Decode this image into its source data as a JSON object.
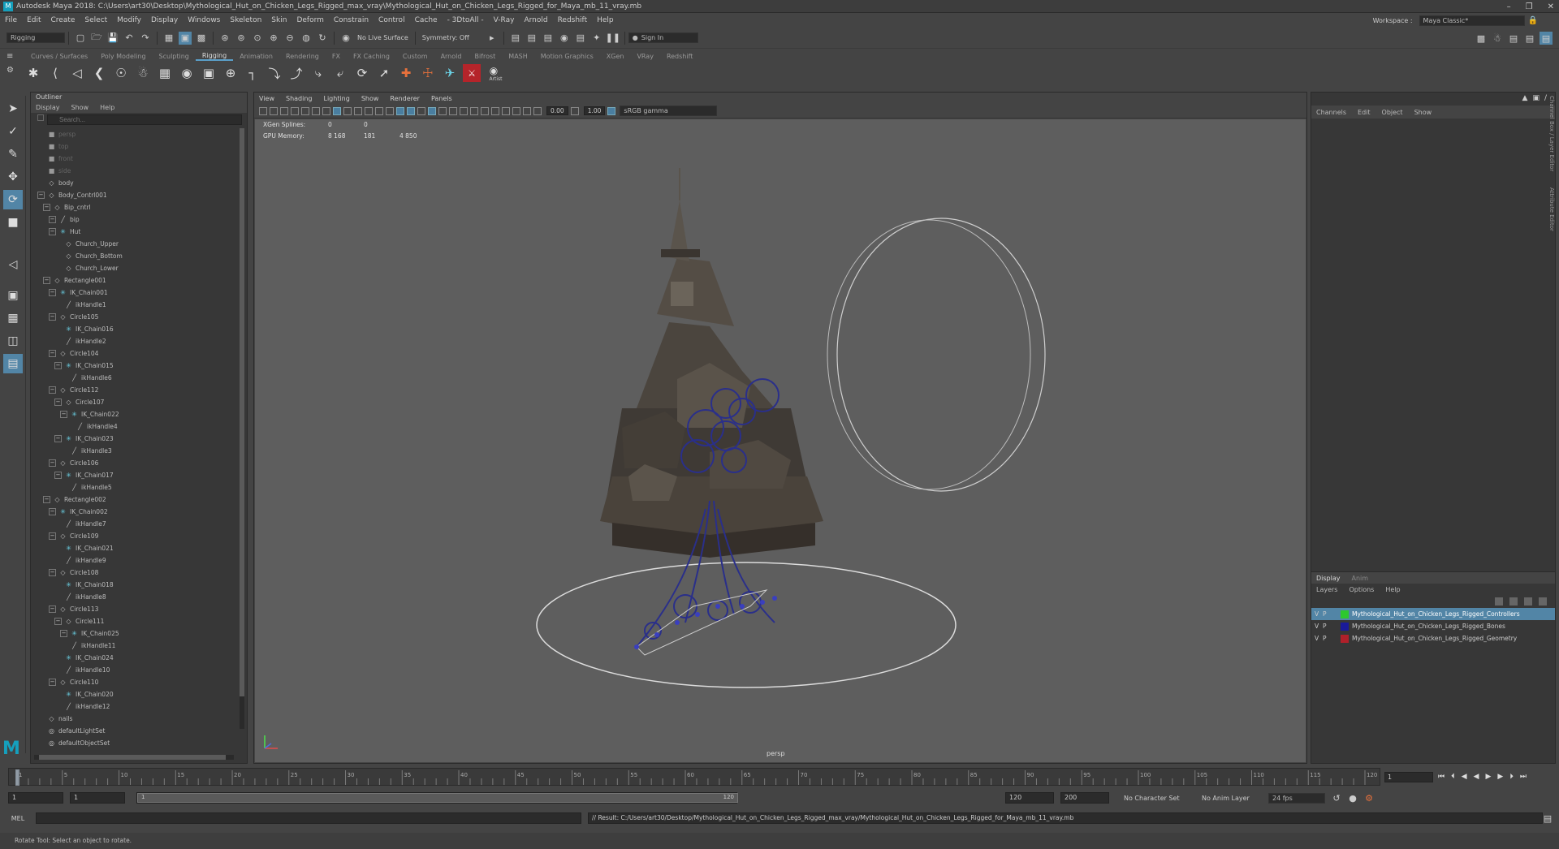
{
  "title": "Autodesk Maya 2018: C:\\Users\\art30\\Desktop\\Mythological_Hut_on_Chicken_Legs_Rigged_max_vray\\Mythological_Hut_on_Chicken_Legs_Rigged_for_Maya_mb_11_vray.mb",
  "menu": [
    "File",
    "Edit",
    "Create",
    "Select",
    "Modify",
    "Display",
    "Windows",
    "Skeleton",
    "Skin",
    "Deform",
    "Constrain",
    "Control",
    "Cache",
    "- 3DtoAll -",
    "V-Ray",
    "Arnold",
    "Redshift",
    "Help"
  ],
  "workspace": {
    "label": "Workspace :",
    "value": "Maya Classic*"
  },
  "statusline": {
    "mode": "Rigging",
    "live_surface": "No Live Surface",
    "symmetry": "Symmetry: Off",
    "sign_in": "Sign In"
  },
  "shelf_tabs": [
    "Curves / Surfaces",
    "Poly Modeling",
    "Sculpting",
    "Rigging",
    "Animation",
    "Rendering",
    "FX",
    "FX Caching",
    "Custom",
    "Arnold",
    "Bifrost",
    "MASH",
    "Motion Graphics",
    "XGen",
    "VRay",
    "Redshift"
  ],
  "shelf_active": "Rigging",
  "shelf_extra_label": "Artist",
  "outliner": {
    "title": "Outliner",
    "menu": [
      "Display",
      "Show",
      "Help"
    ],
    "search_placeholder": "Search...",
    "items": [
      {
        "label": "persp",
        "depth": 0,
        "icon": "cam",
        "dim": true,
        "exp": ""
      },
      {
        "label": "top",
        "depth": 0,
        "icon": "cam",
        "dim": true,
        "exp": ""
      },
      {
        "label": "front",
        "depth": 0,
        "icon": "cam",
        "dim": true,
        "exp": ""
      },
      {
        "label": "side",
        "depth": 0,
        "icon": "cam",
        "dim": true,
        "exp": ""
      },
      {
        "label": "body",
        "depth": 0,
        "icon": "tr",
        "exp": ""
      },
      {
        "label": "Body_Contrl001",
        "depth": 0,
        "icon": "tr",
        "exp": "−"
      },
      {
        "label": "Bip_cntrl",
        "depth": 1,
        "icon": "tr",
        "exp": "−"
      },
      {
        "label": "bip",
        "depth": 2,
        "icon": "ik",
        "exp": "−"
      },
      {
        "label": "Hut",
        "depth": 2,
        "icon": "joint",
        "exp": "−"
      },
      {
        "label": "Church_Upper",
        "depth": 3,
        "icon": "tr",
        "exp": ""
      },
      {
        "label": "Church_Bottom",
        "depth": 3,
        "icon": "tr",
        "exp": ""
      },
      {
        "label": "Church_Lower",
        "depth": 3,
        "icon": "tr",
        "exp": ""
      },
      {
        "label": "Rectangle001",
        "depth": 1,
        "icon": "tr",
        "exp": "−"
      },
      {
        "label": "IK_Chain001",
        "depth": 2,
        "icon": "joint",
        "exp": "−"
      },
      {
        "label": "ikHandle1",
        "depth": 3,
        "icon": "ik",
        "exp": ""
      },
      {
        "label": "Circle105",
        "depth": 2,
        "icon": "tr",
        "exp": "−"
      },
      {
        "label": "IK_Chain016",
        "depth": 3,
        "icon": "joint",
        "exp": ""
      },
      {
        "label": "ikHandle2",
        "depth": 3,
        "icon": "ik",
        "exp": ""
      },
      {
        "label": "Circle104",
        "depth": 2,
        "icon": "tr",
        "exp": "−"
      },
      {
        "label": "IK_Chain015",
        "depth": 3,
        "icon": "joint",
        "exp": "−"
      },
      {
        "label": "ikHandle6",
        "depth": 4,
        "icon": "ik",
        "exp": ""
      },
      {
        "label": "Circle112",
        "depth": 2,
        "icon": "tr",
        "exp": "−"
      },
      {
        "label": "Circle107",
        "depth": 3,
        "icon": "tr",
        "exp": "−"
      },
      {
        "label": "IK_Chain022",
        "depth": 4,
        "icon": "joint",
        "exp": "−"
      },
      {
        "label": "ikHandle4",
        "depth": 5,
        "icon": "ik",
        "exp": ""
      },
      {
        "label": "IK_Chain023",
        "depth": 3,
        "icon": "joint",
        "exp": "−"
      },
      {
        "label": "ikHandle3",
        "depth": 4,
        "icon": "ik",
        "exp": ""
      },
      {
        "label": "Circle106",
        "depth": 2,
        "icon": "tr",
        "exp": "−"
      },
      {
        "label": "IK_Chain017",
        "depth": 3,
        "icon": "joint",
        "exp": "−"
      },
      {
        "label": "ikHandle5",
        "depth": 4,
        "icon": "ik",
        "exp": ""
      },
      {
        "label": "Rectangle002",
        "depth": 1,
        "icon": "tr",
        "exp": "−"
      },
      {
        "label": "IK_Chain002",
        "depth": 2,
        "icon": "joint",
        "exp": "−"
      },
      {
        "label": "ikHandle7",
        "depth": 3,
        "icon": "ik",
        "exp": ""
      },
      {
        "label": "Circle109",
        "depth": 2,
        "icon": "tr",
        "exp": "−"
      },
      {
        "label": "IK_Chain021",
        "depth": 3,
        "icon": "joint",
        "exp": ""
      },
      {
        "label": "ikHandle9",
        "depth": 3,
        "icon": "ik",
        "exp": ""
      },
      {
        "label": "Circle108",
        "depth": 2,
        "icon": "tr",
        "exp": "−"
      },
      {
        "label": "IK_Chain018",
        "depth": 3,
        "icon": "joint",
        "exp": ""
      },
      {
        "label": "ikHandle8",
        "depth": 3,
        "icon": "ik",
        "exp": ""
      },
      {
        "label": "Circle113",
        "depth": 2,
        "icon": "tr",
        "exp": "−"
      },
      {
        "label": "Circle111",
        "depth": 3,
        "icon": "tr",
        "exp": "−"
      },
      {
        "label": "IK_Chain025",
        "depth": 4,
        "icon": "joint",
        "exp": "−"
      },
      {
        "label": "ikHandle11",
        "depth": 4,
        "icon": "ik",
        "exp": ""
      },
      {
        "label": "IK_Chain024",
        "depth": 3,
        "icon": "joint",
        "exp": ""
      },
      {
        "label": "ikHandle10",
        "depth": 3,
        "icon": "ik",
        "exp": ""
      },
      {
        "label": "Circle110",
        "depth": 2,
        "icon": "tr",
        "exp": "−"
      },
      {
        "label": "IK_Chain020",
        "depth": 3,
        "icon": "joint",
        "exp": ""
      },
      {
        "label": "ikHandle12",
        "depth": 3,
        "icon": "ik",
        "exp": ""
      },
      {
        "label": "nails",
        "depth": 0,
        "icon": "tr",
        "exp": ""
      },
      {
        "label": "defaultLightSet",
        "depth": 0,
        "icon": "set",
        "exp": ""
      },
      {
        "label": "defaultObjectSet",
        "depth": 0,
        "icon": "set",
        "exp": ""
      }
    ]
  },
  "viewport": {
    "menu": [
      "View",
      "Shading",
      "Lighting",
      "Show",
      "Renderer",
      "Panels"
    ],
    "exposure": "0.00",
    "gamma": "1.00",
    "colorspace": "sRGB gamma",
    "hud": [
      {
        "key": "XGen Splines:",
        "v1": "0",
        "v2": "0",
        "v3": ""
      },
      {
        "key": "GPU Memory:",
        "v1": "8 168",
        "v2": "181",
        "v3": "4 850"
      }
    ],
    "camera_label": "persp"
  },
  "channelbox": {
    "menu": [
      "Channels",
      "Edit",
      "Object",
      "Show"
    ]
  },
  "layers": {
    "tabs": [
      "Display",
      "Anim"
    ],
    "active_tab": "Display",
    "menu": [
      "Layers",
      "Options",
      "Help"
    ],
    "rows": [
      {
        "v": "V",
        "p": "P",
        "name": "Mythological_Hut_on_Chicken_Legs_Rigged_Controllers",
        "color": "#2ec82e",
        "selected": true
      },
      {
        "v": "V",
        "p": "P",
        "name": "Mythological_Hut_on_Chicken_Legs_Rigged_Bones",
        "color": "#1a1a9a",
        "selected": false
      },
      {
        "v": "V",
        "p": "P",
        "name": "Mythological_Hut_on_Chicken_Legs_Rigged_Geometry",
        "color": "#b0202a",
        "selected": false
      }
    ]
  },
  "side_tabs": [
    "Channel Box / Layer Editor",
    "Attribute Editor"
  ],
  "timeslider": {
    "tick_labels": [
      "1",
      "5",
      "10",
      "15",
      "20",
      "25",
      "30",
      "35",
      "40",
      "45",
      "50",
      "55",
      "60",
      "65",
      "70",
      "75",
      "80",
      "85",
      "90",
      "95",
      "100",
      "105",
      "110",
      "115",
      "120"
    ],
    "current_frame": "1"
  },
  "range": {
    "start": "1",
    "inner_start": "1",
    "slider_start": "1",
    "slider_end": "120",
    "end": "120",
    "outer_end": "200",
    "character_set": "No Character Set",
    "anim_layer": "No Anim Layer",
    "fps": "24 fps"
  },
  "cmdline": {
    "lang": "MEL",
    "result": "// Result: C:/Users/art30/Desktop/Mythological_Hut_on_Chicken_Legs_Rigged_max_vray/Mythological_Hut_on_Chicken_Legs_Rigged_for_Maya_mb_11_vray.mb"
  },
  "helpline": "Rotate Tool: Select an object to rotate."
}
